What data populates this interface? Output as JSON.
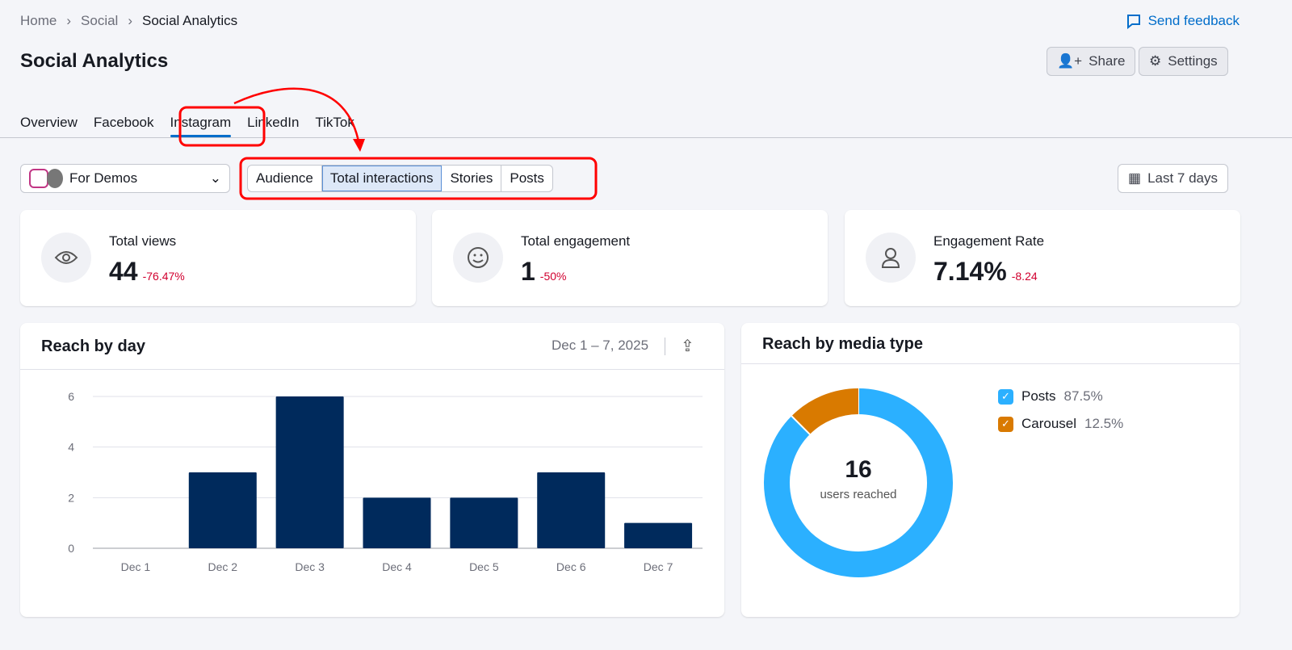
{
  "breadcrumb": [
    "Home",
    "Social",
    "Social Analytics"
  ],
  "send_feedback": "Send feedback",
  "page_title": "Social Analytics",
  "share": "Share",
  "settings": "Settings",
  "tabs": [
    "Overview",
    "Facebook",
    "Instagram",
    "LinkedIn",
    "TikTok"
  ],
  "active_tab": "Instagram",
  "account_select": "For Demos",
  "subtabs": [
    "Audience",
    "Total interactions",
    "Stories",
    "Posts"
  ],
  "active_subtab": "Total interactions",
  "date_range": "Last 7 days",
  "kpis": [
    {
      "label": "Total views",
      "value": "44",
      "delta": "-76.47%",
      "icon": "eye-icon"
    },
    {
      "label": "Total engagement",
      "value": "1",
      "delta": "-50%",
      "icon": "smiley-icon"
    },
    {
      "label": "Engagement Rate",
      "value": "7.14%",
      "delta": "-8.24",
      "icon": "user-icon"
    }
  ],
  "reach_by_day": {
    "title": "Reach by day",
    "date": "Dec 1 – 7, 2025"
  },
  "reach_by_media": {
    "title": "Reach by media type",
    "total": "16",
    "total_label": "users reached"
  },
  "chart_data": [
    {
      "type": "bar",
      "categories": [
        "Dec 1",
        "Dec 2",
        "Dec 3",
        "Dec 4",
        "Dec 5",
        "Dec 6",
        "Dec 7"
      ],
      "values": [
        0,
        3,
        6,
        2,
        2,
        3,
        1
      ],
      "yticks": [
        "0",
        "2",
        "4",
        "6"
      ],
      "ylim": [
        0,
        6
      ],
      "grid": true,
      "color": "#002a5c"
    },
    {
      "type": "pie",
      "donut": true,
      "series": [
        {
          "name": "Posts",
          "value": 87.5,
          "label": "87.5%",
          "color": "#2bb0ff"
        },
        {
          "name": "Carousel",
          "value": 12.5,
          "label": "12.5%",
          "color": "#d97a00"
        }
      ]
    }
  ]
}
